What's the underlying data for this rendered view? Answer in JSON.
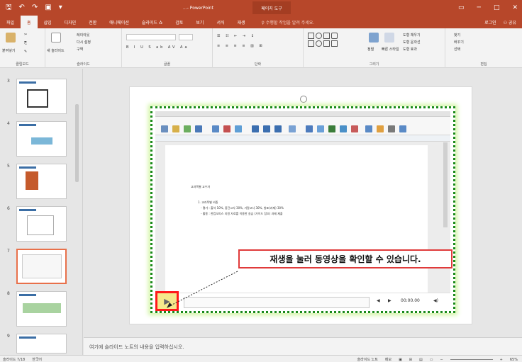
{
  "titlebar": {
    "title": "...- PowerPoint",
    "context_tab": "페이지 도구",
    "controls": [
      "─",
      "□",
      "✕"
    ]
  },
  "tabs": {
    "items": [
      "파일",
      "홈",
      "삽입",
      "디자인",
      "전환",
      "애니메이션",
      "슬라이드 쇼",
      "검토",
      "보기",
      "서식",
      "재생"
    ],
    "tell_me": "수행할 작업을 알려 주세요.",
    "login": "로그인",
    "share": "공유"
  },
  "ribbon": {
    "clipboard_label": "클립보드",
    "slides_label": "슬라이드",
    "font_label": "글꼴",
    "paragraph_label": "단락",
    "drawing_label": "그리기",
    "editing_label": "편집",
    "paste": "붙여넣기",
    "new_slide": "새 슬라이드",
    "layout": "레이아웃",
    "reset": "다시 설정",
    "section": "구역",
    "arrange": "정렬",
    "quick_styles": "빠른 스타일",
    "shape_fill": "도형 채우기",
    "shape_outline": "도형 윤곽선",
    "shape_effects": "도형 효과",
    "find": "찾기",
    "replace": "바꾸기",
    "select": "선택"
  },
  "thumbnails": {
    "numbers": [
      "3",
      "4",
      "5",
      "6",
      "7",
      "8",
      "9"
    ],
    "selected_index": 4
  },
  "video": {
    "heading": "교과목별 교수자",
    "line1": "1. 교과목별 비중",
    "line2": "- 평가 : 출석 10%, 중간고사 30%, 기말고사 30%, 발표(과제) 30%",
    "line3": "- 활용 : 한컴오피스 지원 자료를 이용한 실습 (가이드 참조) 과제 제출"
  },
  "player": {
    "play_icon": "▶",
    "back": "◀",
    "forward": "▶",
    "time": "00:00.00",
    "volume": "◀)"
  },
  "callout": "재생을 눌러 동영상을 확인할 수 있습니다.",
  "notes_placeholder": "여기에 슬라이드 노트의 내용을 입력하십시오.",
  "status": {
    "slide_info": "슬라이드 7/18",
    "language": "한국어",
    "notes_btn": "슬라이드 노트",
    "comments_btn": "메모",
    "zoom": "65%"
  }
}
